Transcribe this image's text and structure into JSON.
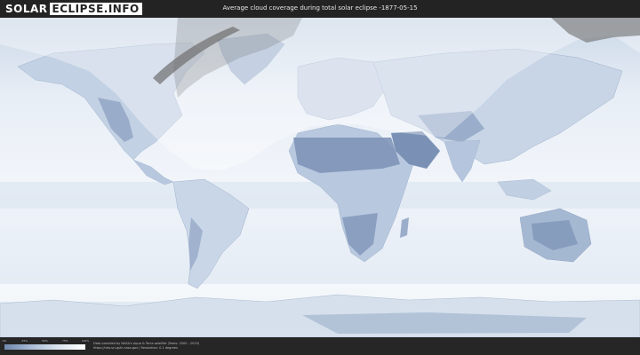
{
  "header": {
    "logo_left": "SOLAR",
    "logo_right": "ECLIPSE.INFO",
    "title": "Average cloud coverage during total solar eclipse -1877-05-15"
  },
  "legend": {
    "ticks": [
      "0%",
      "25%",
      "50%",
      "75%",
      "100%"
    ],
    "colors": [
      "#6f88ad",
      "#a9bbd4",
      "#dbe4ef",
      "#ffffff"
    ]
  },
  "footer": {
    "credit_line1": "Data provided by NASA's Aqua & Terra satellite (Years: 2000 - 2019)",
    "credit_line2": "https://neo.sci.gsfc.nasa.gov  |  Resolution: 0.1 degrees"
  },
  "colors": {
    "ocean": "#e9eff7",
    "land_cloudy": "#c9d6e6",
    "land_clear": "#6f88ad",
    "eclipse_shadow": "#8e8e8e"
  }
}
